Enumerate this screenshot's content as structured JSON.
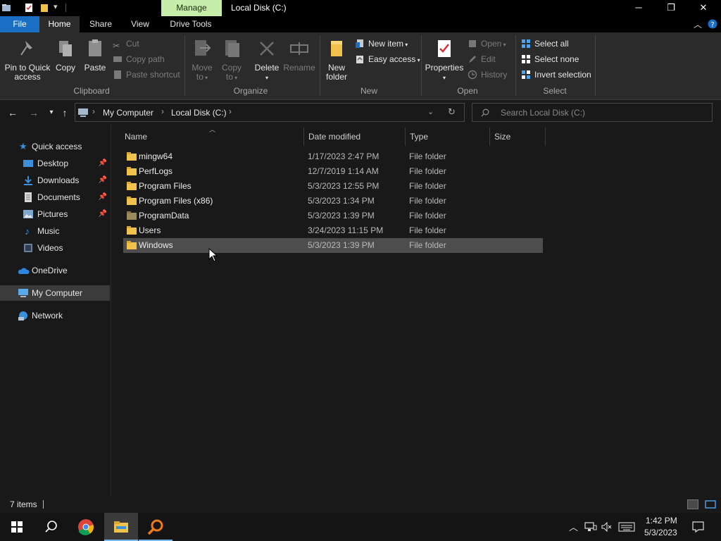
{
  "titlebar": {
    "manage_tab": "Manage",
    "title": "Local Disk (C:)",
    "minimize": "─",
    "maximize": "❐",
    "close": "✕"
  },
  "ribbon_tabs": {
    "file": "File",
    "home": "Home",
    "share": "Share",
    "view": "View",
    "drive_tools": "Drive Tools"
  },
  "ribbon": {
    "clipboard": {
      "label": "Clipboard",
      "pin": "Pin to Quick access",
      "pin_line1": "Pin to Quick",
      "pin_line2": "access",
      "copy": "Copy",
      "paste": "Paste",
      "cut": "Cut",
      "copy_path": "Copy path",
      "paste_shortcut": "Paste shortcut"
    },
    "organize": {
      "label": "Organize",
      "move_to_1": "Move",
      "move_to_2": "to",
      "copy_to_1": "Copy",
      "copy_to_2": "to",
      "delete": "Delete",
      "rename": "Rename"
    },
    "new": {
      "label": "New",
      "new_folder_1": "New",
      "new_folder_2": "folder",
      "new_item": "New item",
      "easy_access": "Easy access"
    },
    "open": {
      "label": "Open",
      "properties": "Properties",
      "open": "Open",
      "edit": "Edit",
      "history": "History"
    },
    "select": {
      "label": "Select",
      "select_all": "Select all",
      "select_none": "Select none",
      "invert": "Invert selection"
    }
  },
  "address": {
    "crumbs": [
      "My Computer",
      "Local Disk (C:)"
    ],
    "search_placeholder": "Search Local Disk (C:)"
  },
  "navpane": {
    "quick_access": "Quick access",
    "items": [
      {
        "label": "Desktop",
        "pinned": true
      },
      {
        "label": "Downloads",
        "pinned": true
      },
      {
        "label": "Documents",
        "pinned": true
      },
      {
        "label": "Pictures",
        "pinned": true
      },
      {
        "label": "Music",
        "pinned": false
      },
      {
        "label": "Videos",
        "pinned": false
      }
    ],
    "onedrive": "OneDrive",
    "my_computer": "My Computer",
    "network": "Network"
  },
  "columns": {
    "name": "Name",
    "date": "Date modified",
    "type": "Type",
    "size": "Size"
  },
  "files": [
    {
      "name": "mingw64",
      "date": "1/17/2023 2:47 PM",
      "type": "File folder",
      "icon": "folder-icon"
    },
    {
      "name": "PerfLogs",
      "date": "12/7/2019 1:14 AM",
      "type": "File folder",
      "icon": "folder-icon"
    },
    {
      "name": "Program Files",
      "date": "5/3/2023 12:55 PM",
      "type": "File folder",
      "icon": "folder-icon"
    },
    {
      "name": "Program Files (x86)",
      "date": "5/3/2023 1:34 PM",
      "type": "File folder",
      "icon": "folder-icon"
    },
    {
      "name": "ProgramData",
      "date": "5/3/2023 1:39 PM",
      "type": "File folder",
      "icon": "hidden-folder-icon"
    },
    {
      "name": "Users",
      "date": "3/24/2023 11:15 PM",
      "type": "File folder",
      "icon": "folder-icon"
    },
    {
      "name": "Windows",
      "date": "5/3/2023 1:39 PM",
      "type": "File folder",
      "icon": "folder-icon",
      "selected": true
    }
  ],
  "status": {
    "count": "7 items"
  },
  "taskbar": {
    "time": "1:42 PM",
    "date": "5/3/2023"
  },
  "colors": {
    "accent": "#1a6fc4",
    "folder": "#f0c24b",
    "manage": "#c6edaa"
  }
}
